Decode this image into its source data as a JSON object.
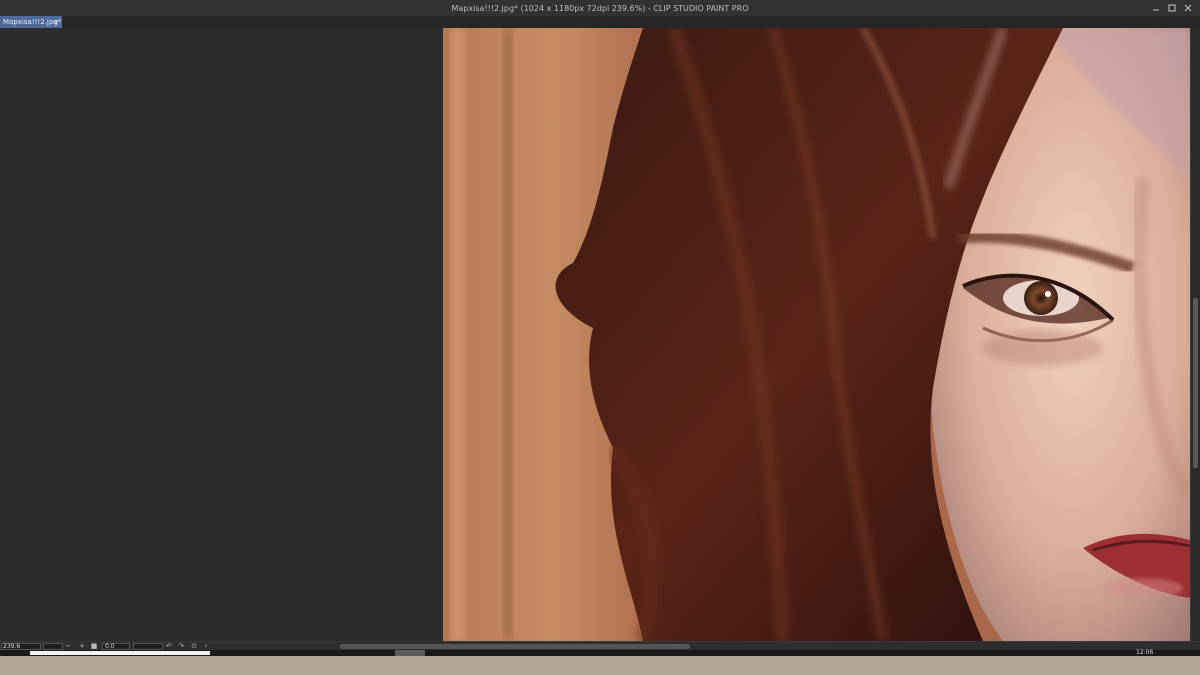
{
  "window": {
    "title": "Мархіsa!!!2.jpg* (1024 x 1180px 72dpi 239.6%)  -  CLIP STUDIO PAINT PRO",
    "controls": [
      "minimize-icon",
      "maximize-icon",
      "close-icon"
    ]
  },
  "tabs": [
    {
      "label": "Мархіsa!!!2.jpg*",
      "close": "×",
      "active": true
    }
  ],
  "canvas": {
    "artwork": "digital painting of a woman's face with dark auburn hair"
  },
  "statusbar": {
    "zoom": "239.6",
    "zoom_out": "−",
    "zoom_in": "+",
    "angle": "0.0",
    "icons": [
      "fit-icon",
      "rotate-left-icon",
      "rotate-right-icon",
      "reset-rotation-icon",
      "flip-icon"
    ]
  },
  "taskbar": {
    "clock": "12:06"
  },
  "colors": {
    "tab_active": "#4f6b99",
    "workspace": "#2c2c2c",
    "desktop": "#b3a795"
  }
}
